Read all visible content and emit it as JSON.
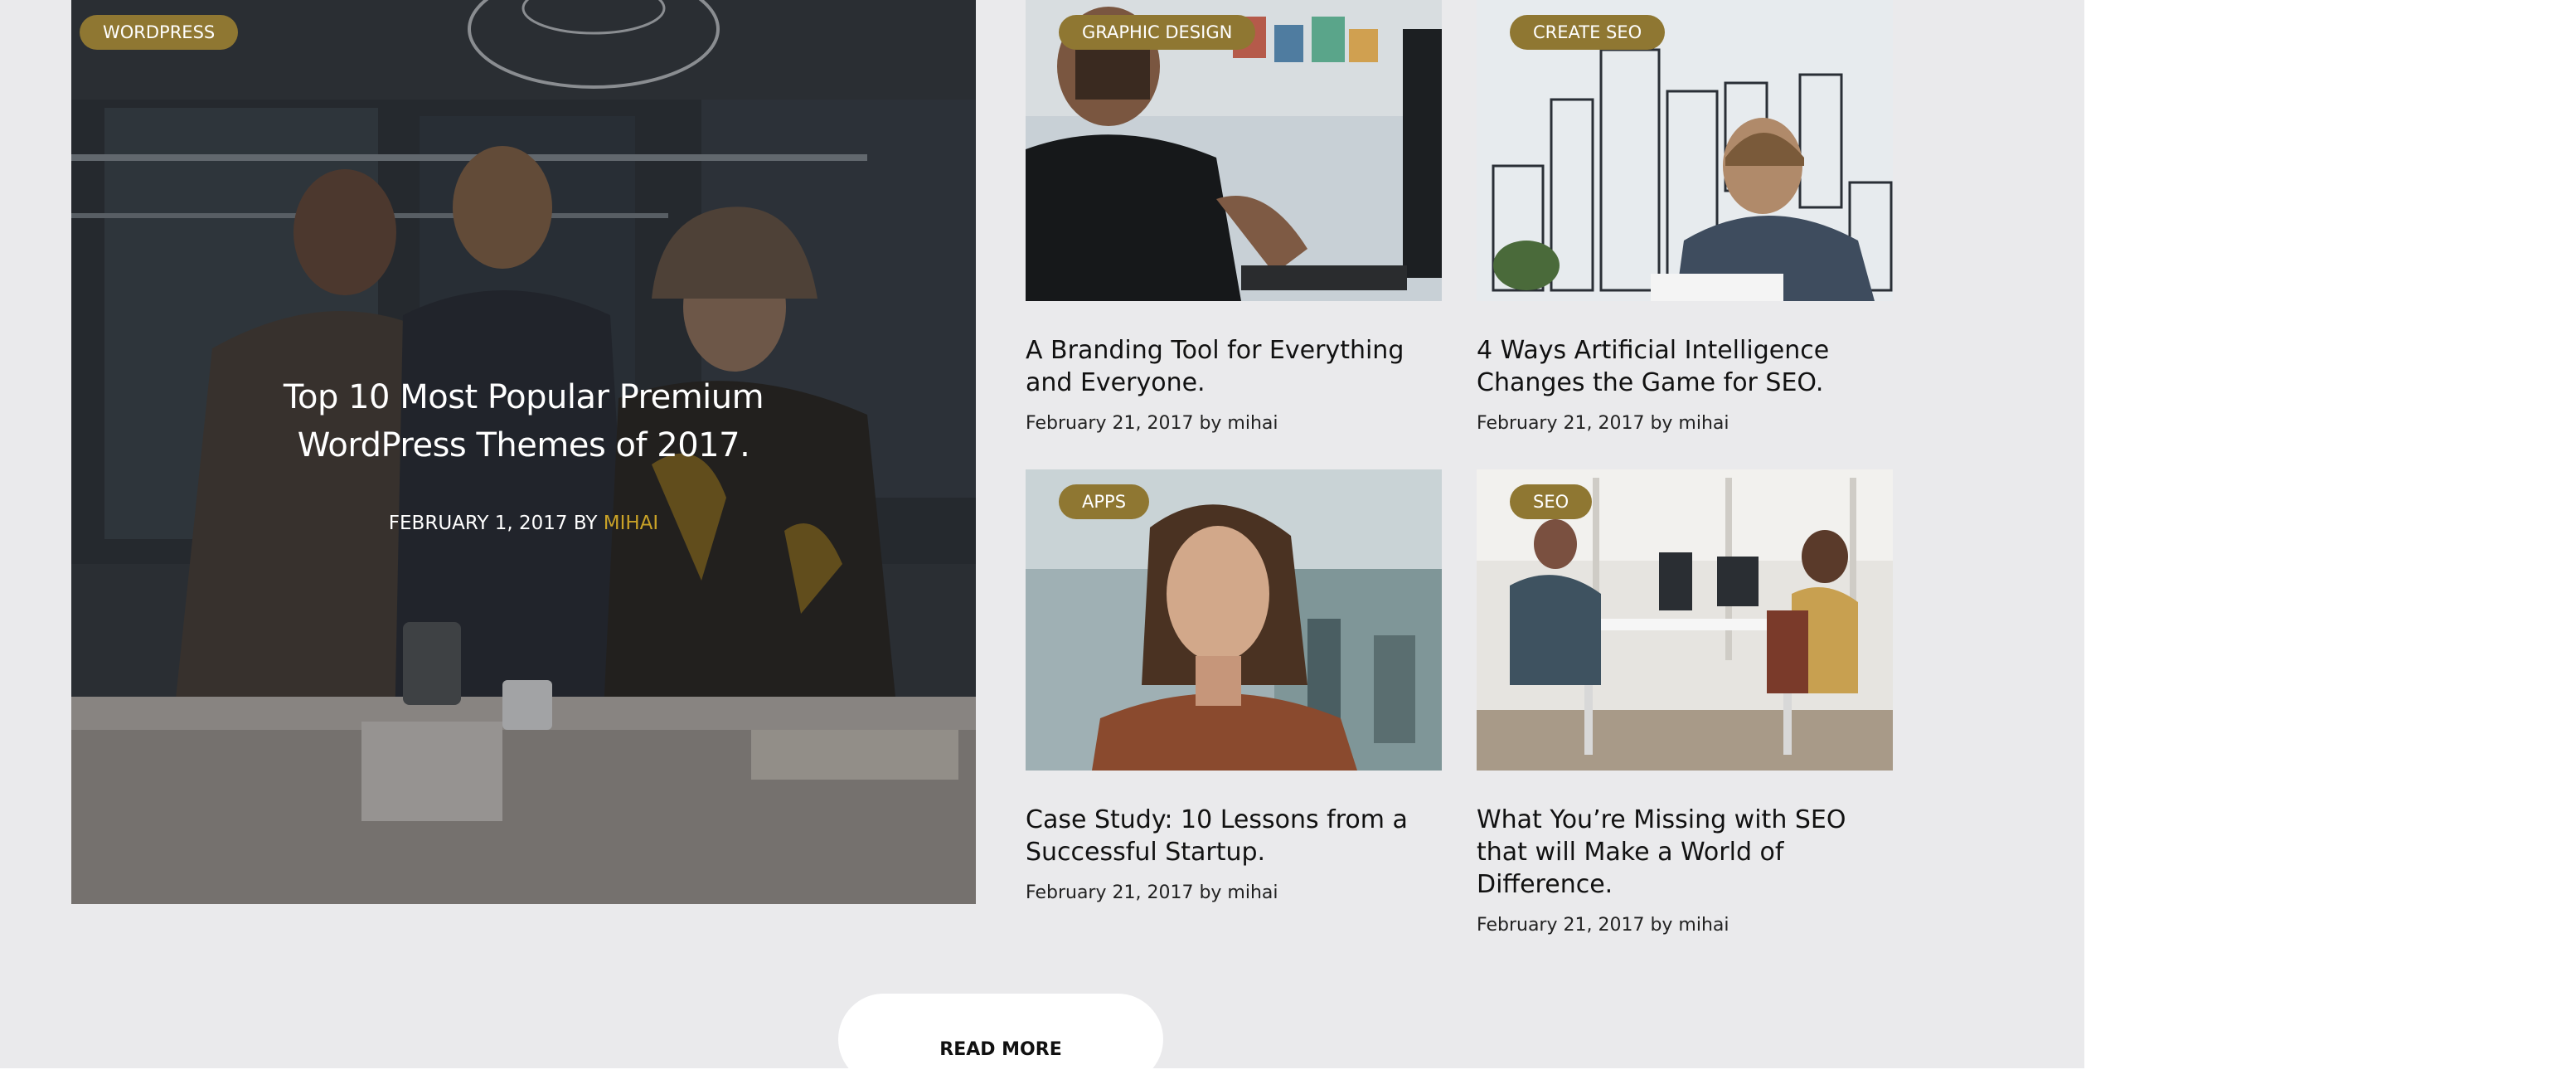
{
  "featured": {
    "category": "WORDPRESS",
    "title": "Top 10 Most Popular Premium WordPress Themes of 2017.",
    "date": "FEBRUARY 1, 2017",
    "by": "BY",
    "author": "MIHAI"
  },
  "cards": [
    {
      "category": "GRAPHIC DESIGN",
      "title": "A Branding Tool for Everything and Everyone.",
      "meta": "February 21, 2017 by mihai"
    },
    {
      "category": "CREATE SEO",
      "title": "4 Ways Artificial Intelligence Changes the Game for SEO.",
      "meta": "February 21, 2017 by mihai"
    },
    {
      "category": "APPS",
      "title": "Case Study: 10 Lessons from a Successful Startup.",
      "meta": "February 21, 2017 by mihai"
    },
    {
      "category": "SEO",
      "title": "What You’re Missing with SEO that will Make a World of Difference.",
      "meta": "February 21, 2017 by mihai"
    }
  ],
  "read_more": {
    "label": "READ MORE"
  },
  "colors": {
    "badge": "#8f7732",
    "author_accent": "#c9a227",
    "section_bg": "#eaeaec"
  }
}
